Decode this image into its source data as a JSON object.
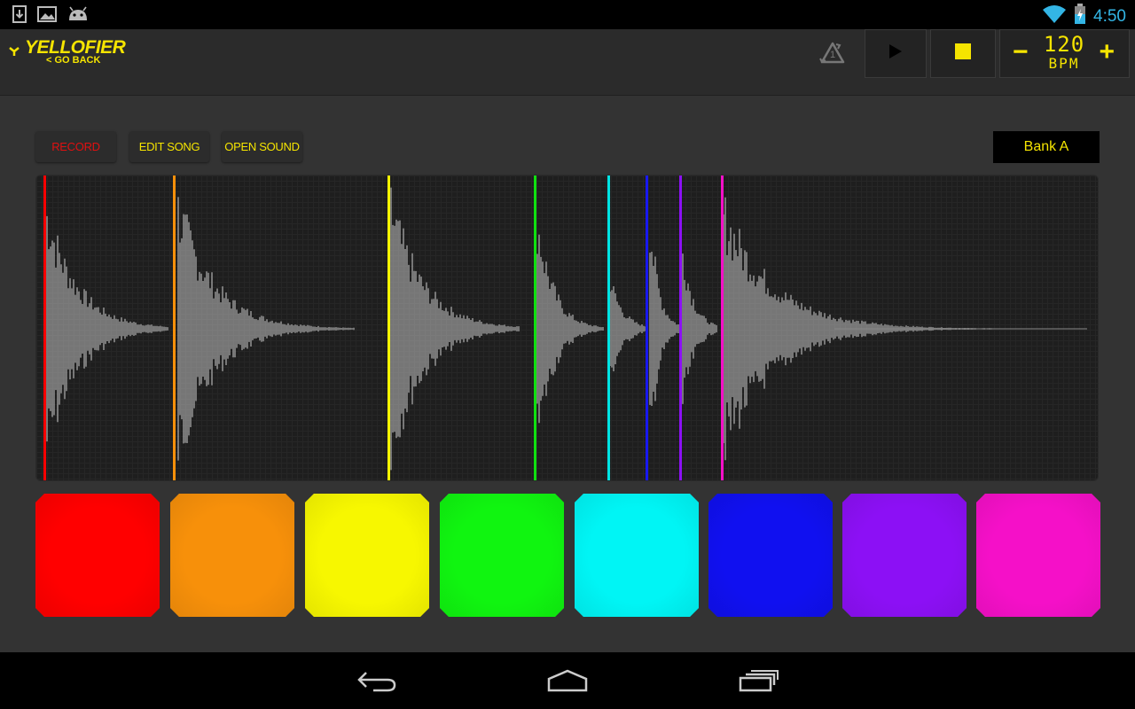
{
  "status_bar": {
    "time": "4:50",
    "left_icons": [
      "download-icon",
      "image-icon",
      "android-icon"
    ],
    "right_icons": [
      "wifi-icon",
      "battery-charging-icon"
    ]
  },
  "header": {
    "logo_title": "YELLOFIER",
    "back_label": "< GO BACK",
    "recycle_count": "1",
    "bpm_value": "120",
    "bpm_unit": "BPM",
    "bpm_minus": "−",
    "bpm_plus": "+"
  },
  "toolbar": {
    "record_label": "RECORD",
    "edit_song_label": "EDIT SONG",
    "open_sound_label": "OPEN SOUND",
    "bank_label": "Bank A"
  },
  "colors": {
    "accent": "#f5e400",
    "record": "#e01010",
    "background": "#333333"
  },
  "pads": [
    {
      "name": "pad-red",
      "color": "#ff0000"
    },
    {
      "name": "pad-orange",
      "color": "#f7900a"
    },
    {
      "name": "pad-yellow",
      "color": "#f7f700"
    },
    {
      "name": "pad-green",
      "color": "#10f510"
    },
    {
      "name": "pad-cyan",
      "color": "#00f5f5"
    },
    {
      "name": "pad-blue",
      "color": "#1010f0"
    },
    {
      "name": "pad-purple",
      "color": "#8c10f5"
    },
    {
      "name": "pad-magenta",
      "color": "#f510c8"
    }
  ],
  "markers": [
    {
      "name": "marker-red",
      "color": "#ff0000"
    },
    {
      "name": "marker-orange",
      "color": "#f7900a"
    },
    {
      "name": "marker-yellow",
      "color": "#f7f700"
    },
    {
      "name": "marker-green",
      "color": "#10e010"
    },
    {
      "name": "marker-cyan",
      "color": "#00e5e5"
    },
    {
      "name": "marker-blue",
      "color": "#1818f0"
    },
    {
      "name": "marker-purple",
      "color": "#8c10f5"
    },
    {
      "name": "marker-magenta",
      "color": "#f510c8"
    }
  ]
}
